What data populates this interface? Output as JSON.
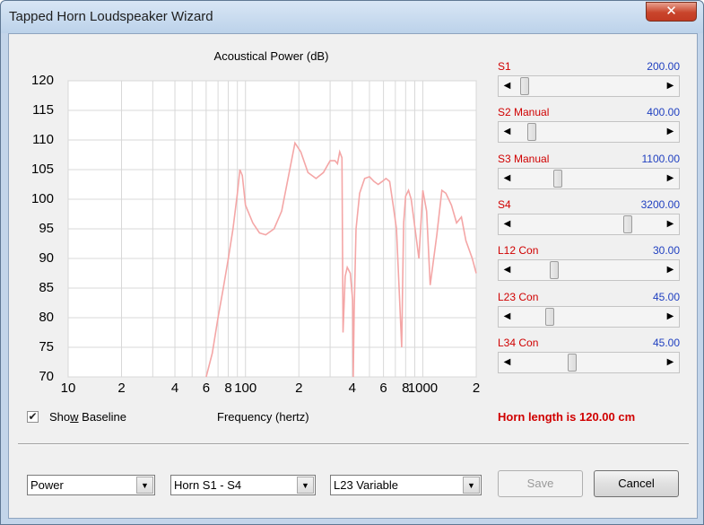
{
  "window": {
    "title": "Tapped Horn Loudspeaker Wizard",
    "close_glyph": "✕"
  },
  "chart_data": {
    "type": "line",
    "title": "Acoustical Power (dB)",
    "xlabel": "Frequency (hertz)",
    "ylabel": "",
    "xscale": "log",
    "xlim": [
      10,
      2000
    ],
    "ylim": [
      70,
      120
    ],
    "grid": true,
    "ytick_labels": [
      "120",
      "115",
      "110",
      "105",
      "100",
      "95",
      "90",
      "85",
      "80",
      "75",
      "70"
    ],
    "xtick_labels": [
      "10",
      "2",
      "4",
      "6",
      "8",
      "100",
      "2",
      "4",
      "6",
      "8",
      "1000",
      "2"
    ],
    "series": [
      {
        "color": "#f4a6a6",
        "x": [
          60,
          65,
          70,
          75,
          80,
          85,
          90,
          93,
          96,
          100,
          110,
          120,
          130,
          145,
          160,
          175,
          190,
          205,
          225,
          250,
          275,
          300,
          320,
          330,
          340,
          350,
          352,
          355,
          365,
          375,
          390,
          402,
          405,
          410,
          420,
          440,
          470,
          500,
          530,
          560,
          590,
          620,
          650,
          680,
          710,
          740,
          760,
          770,
          780,
          800,
          830,
          860,
          900,
          950,
          1000,
          1050,
          1100,
          1200,
          1280,
          1350,
          1450,
          1550,
          1650,
          1750,
          1900,
          2000
        ],
        "y": [
          70,
          74,
          80,
          85,
          90,
          95,
          101,
          105,
          104,
          99,
          96,
          94.3,
          94,
          95,
          98,
          104,
          109.5,
          108,
          104.5,
          103.5,
          104.5,
          106.5,
          106.5,
          106,
          108,
          107,
          95,
          77.5,
          87,
          88.5,
          87.5,
          83,
          70,
          81,
          95,
          101,
          103.5,
          103.8,
          103,
          102.5,
          103,
          103.5,
          103,
          99,
          95,
          83,
          75,
          86,
          96,
          100.5,
          101.5,
          100,
          95.5,
          90,
          101.5,
          98,
          85.5,
          94,
          101.5,
          101,
          99,
          96,
          97,
          93,
          90,
          87.5
        ]
      }
    ]
  },
  "options": {
    "show_baseline_label": "Show Baseline",
    "show_baseline_checked": true,
    "check_glyph": "✔",
    "horn_length_text": "Horn length is 120.00 cm"
  },
  "sliders": [
    {
      "label": "S1",
      "value": "200.00",
      "position": 0.04
    },
    {
      "label": "S2  Manual",
      "value": "400.00",
      "position": 0.09
    },
    {
      "label": "S3  Manual",
      "value": "1100.00",
      "position": 0.28
    },
    {
      "label": "S4",
      "value": "3200.00",
      "position": 0.78
    },
    {
      "label": "L12  Con",
      "value": "30.00",
      "position": 0.25
    },
    {
      "label": "L23  Con",
      "value": "45.00",
      "position": 0.22
    },
    {
      "label": "L34  Con",
      "value": "45.00",
      "position": 0.38
    }
  ],
  "scroll_arrows": {
    "left": "◀",
    "right": "▶"
  },
  "bottom": {
    "combo1": "Power",
    "combo2": "Horn S1 - S4",
    "combo3": "L23 Variable",
    "combo_arrow": "▼",
    "save_label": "Save",
    "cancel_label": "Cancel"
  }
}
